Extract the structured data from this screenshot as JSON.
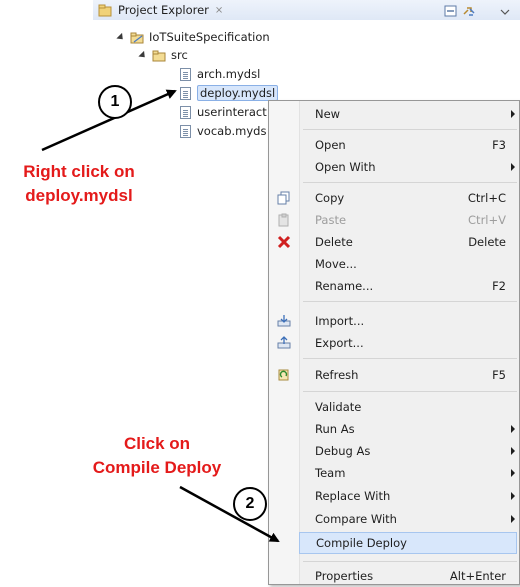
{
  "panel": {
    "title": "Project Explorer",
    "close_glyph": "⨯"
  },
  "tree": {
    "project": "IoTSuiteSpecification",
    "folder": "src",
    "files": [
      "arch.mydsl",
      "deploy.mydsl",
      "userinteract",
      "vocab.myds"
    ]
  },
  "menu": {
    "new": "New",
    "open": "Open",
    "open_sc": "F3",
    "open_with": "Open With",
    "copy": "Copy",
    "copy_sc": "Ctrl+C",
    "paste": "Paste",
    "paste_sc": "Ctrl+V",
    "delete": "Delete",
    "delete_sc": "Delete",
    "move": "Move...",
    "rename": "Rename...",
    "rename_sc": "F2",
    "import": "Import...",
    "export": "Export...",
    "refresh": "Refresh",
    "refresh_sc": "F5",
    "validate": "Validate",
    "run_as": "Run As",
    "debug_as": "Debug As",
    "team": "Team",
    "replace_with": "Replace With",
    "compare_with": "Compare With",
    "compile_deploy": "Compile Deploy",
    "properties": "Properties",
    "properties_sc": "Alt+Enter"
  },
  "annotations": {
    "step1_number": "1",
    "step1_line1": "Right click on",
    "step1_line2": "deploy.mydsl",
    "step2_number": "2",
    "step2_line1": "Click on",
    "step2_line2": "Compile Deploy"
  },
  "colors": {
    "annotation": "#e41a1a",
    "highlight": "#d8e7fb",
    "menu_bg": "#f0f0f0"
  }
}
